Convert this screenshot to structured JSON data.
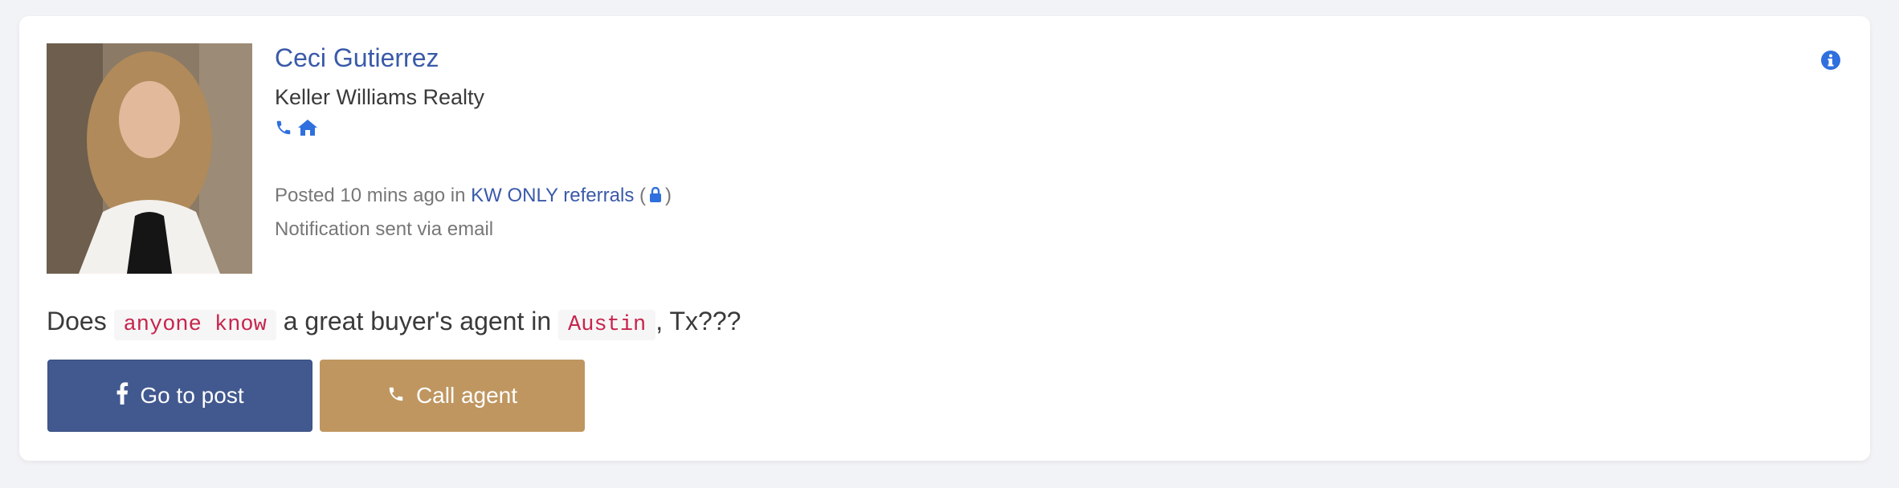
{
  "agent": {
    "name": "Ceci Gutierrez",
    "company": "Keller Williams Realty",
    "photo_icon": "agent-photo"
  },
  "meta": {
    "posted_prefix": "Posted 10 mins ago in ",
    "group_name": "KW ONLY referrals",
    "paren_open": " (",
    "paren_close": ")",
    "notification": "Notification sent via email"
  },
  "post": {
    "part1": "Does ",
    "code1": "anyone know",
    "part2": " a great buyer's agent in ",
    "code2": "Austin",
    "part3": ", Tx???"
  },
  "buttons": {
    "go_to_post": "Go to post",
    "call_agent": "Call agent"
  },
  "colors": {
    "link": "#3a5aa8",
    "icon_blue": "#2f6fde",
    "facebook_button": "#42598f",
    "call_button": "#bf9660",
    "code_text": "#c7254e"
  },
  "icons": [
    "phone-icon",
    "home-icon",
    "info-icon",
    "lock-icon",
    "facebook-icon"
  ]
}
